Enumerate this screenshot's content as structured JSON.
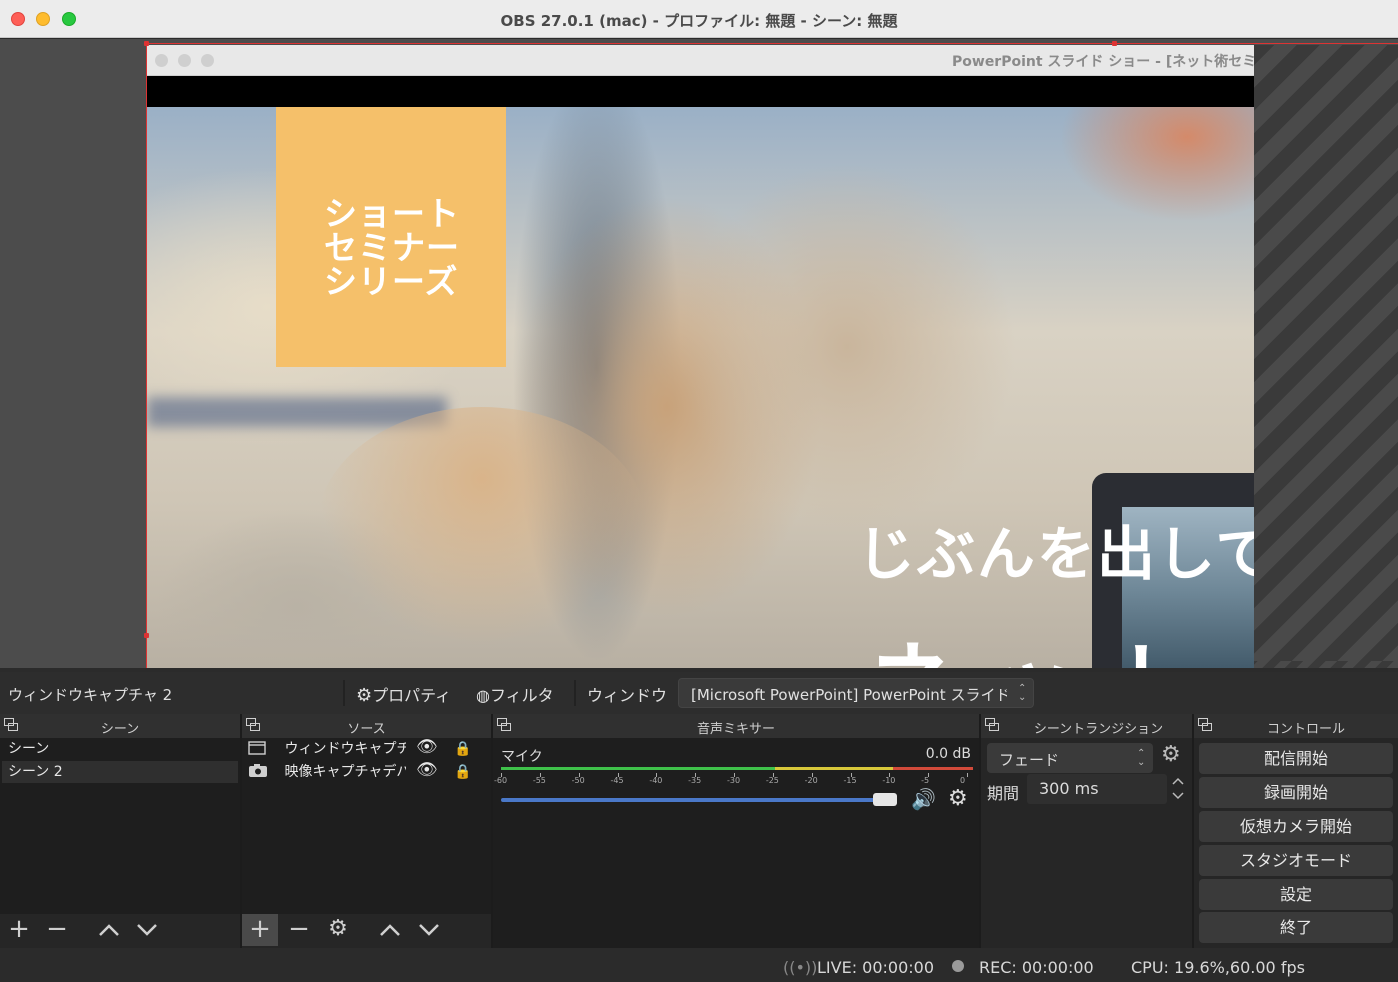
{
  "window": {
    "title": "OBS 27.0.1 (mac) - プロファイル: 無題 - シーン: 無題"
  },
  "preview": {
    "captured_window_title": "PowerPoint スライド ショー - [ネット術セミナ",
    "slide": {
      "badge_lines": [
        "ショート",
        "セミナー",
        "シリーズ"
      ],
      "headline": "じぶんを出して",
      "big_text": "ネット"
    }
  },
  "source_toolbar": {
    "selected_source": "ウィンドウキャプチャ 2",
    "properties_label": "プロパティ",
    "filters_label": "フィルタ",
    "window_label": "ウィンドウ",
    "window_value": "[Microsoft PowerPoint] PowerPoint スライド ショー"
  },
  "docks": {
    "scenes": {
      "title": "シーン",
      "items": [
        "シーン",
        "シーン 2"
      ],
      "selected": 1
    },
    "sources": {
      "title": "ソース",
      "items": [
        {
          "name": "ウィンドウキャプチャ",
          "icon": "window-icon"
        },
        {
          "name": "映像キャプチャデバイス",
          "icon": "camera-icon"
        }
      ]
    },
    "mixer": {
      "title": "音声ミキサー",
      "channel": "マイク",
      "level": "0.0 dB",
      "scale": [
        "-60",
        "-55",
        "-50",
        "-45",
        "-40",
        "-35",
        "-30",
        "-25",
        "-20",
        "-15",
        "-10",
        "-5",
        "0"
      ],
      "volume_fraction": 0.98
    },
    "transitions": {
      "title": "シーントランジション",
      "transition": "フェード",
      "duration_label": "期間",
      "duration": "300 ms"
    },
    "controls": {
      "title": "コントロール",
      "buttons": [
        "配信開始",
        "録画開始",
        "仮想カメラ開始",
        "スタジオモード",
        "設定",
        "終了"
      ]
    }
  },
  "status": {
    "live": "LIVE: 00:00:00",
    "rec": "REC: 00:00:00",
    "cpu": "CPU: 19.6%,60.00 fps"
  },
  "colors": {
    "accent_blue": "#4a78c8",
    "meter_green": "#3fc24a",
    "meter_yellow": "#d8c83a",
    "meter_red": "#d24a3a",
    "slide_badge": "#f5c06a"
  }
}
